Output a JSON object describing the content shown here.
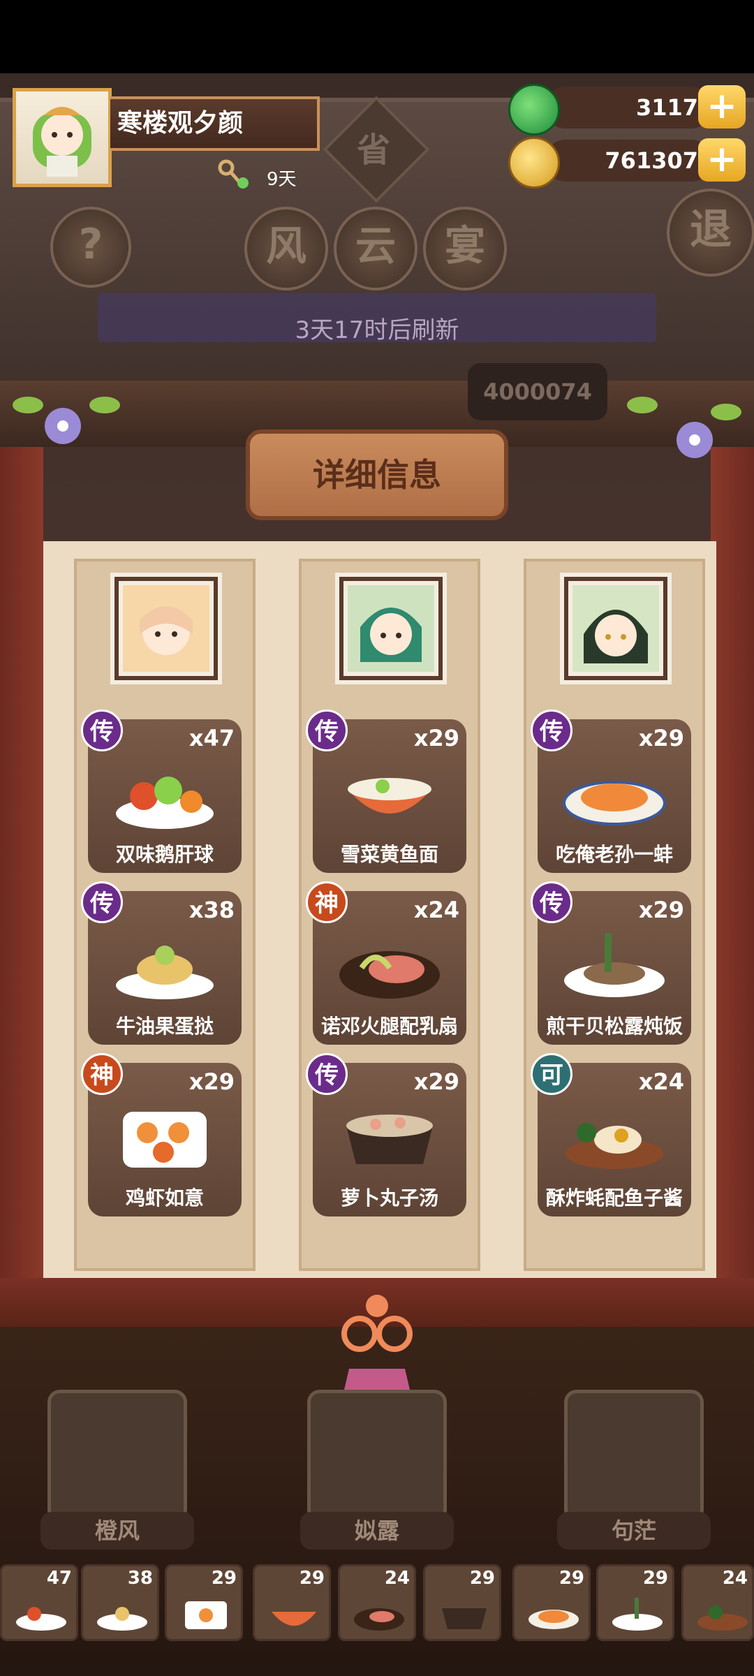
{
  "player": {
    "name": "寒楼观夕颜",
    "days_label": "9天"
  },
  "currency": {
    "jade": "3117",
    "coins": "761307"
  },
  "buttons": {
    "help": "?",
    "exit": "退",
    "province": "省"
  },
  "title_chars": [
    "风",
    "云",
    "宴"
  ],
  "refresh_text": "3天17时后刷新",
  "score_text": "4000074",
  "detail_title": "详细信息",
  "columns": [
    {
      "dishes": [
        {
          "badge": "传",
          "tier": "chuan",
          "count": "x47",
          "name": "双味鹅肝球"
        },
        {
          "badge": "传",
          "tier": "chuan",
          "count": "x38",
          "name": "牛油果蛋挞"
        },
        {
          "badge": "神",
          "tier": "shen",
          "count": "x29",
          "name": "鸡虾如意"
        }
      ]
    },
    {
      "dishes": [
        {
          "badge": "传",
          "tier": "chuan",
          "count": "x29",
          "name": "雪菜黄鱼面"
        },
        {
          "badge": "神",
          "tier": "shen",
          "count": "x24",
          "name": "诺邓火腿配乳扇"
        },
        {
          "badge": "传",
          "tier": "chuan",
          "count": "x29",
          "name": "萝卜丸子汤"
        }
      ]
    },
    {
      "dishes": [
        {
          "badge": "传",
          "tier": "chuan",
          "count": "x29",
          "name": "吃俺老孙一蚌"
        },
        {
          "badge": "传",
          "tier": "chuan",
          "count": "x29",
          "name": "煎干贝松露炖饭"
        },
        {
          "badge": "可",
          "tier": "ke",
          "count": "x24",
          "name": "酥炸蚝配鱼子酱"
        }
      ]
    }
  ],
  "chefs": [
    "橙风",
    "姒露",
    "句茫"
  ],
  "thumbnails": [
    "47",
    "38",
    "29",
    "29",
    "24",
    "29",
    "29",
    "29",
    "24"
  ],
  "colors": {
    "frame": "#7a3024",
    "panel": "#ecdcc4",
    "card": "#6b4e3e",
    "badge_chuan": "#6b2b8a",
    "badge_shen": "#c84a1c",
    "badge_ke": "#2e6f74",
    "gold": "#e7a623"
  }
}
